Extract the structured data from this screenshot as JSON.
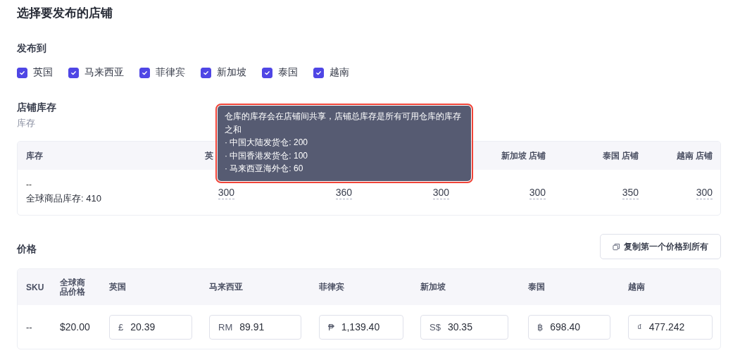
{
  "title": "选择要发布的店铺",
  "publish_to": {
    "label": "发布到",
    "options": [
      {
        "label": "英国",
        "checked": true
      },
      {
        "label": "马来西亚",
        "checked": true
      },
      {
        "label": "菲律宾",
        "checked": true
      },
      {
        "label": "新加坡",
        "checked": true
      },
      {
        "label": "泰国",
        "checked": true
      },
      {
        "label": "越南",
        "checked": true
      }
    ]
  },
  "inventory": {
    "heading": "店铺库存",
    "subheading": "库存",
    "columns": [
      "库存",
      "英",
      "新加坡 店铺",
      "泰国 店铺",
      "越南 店铺"
    ],
    "rows": [
      {
        "sku": "--",
        "global_stock": "全球商品库存: 410",
        "values": [
          "300",
          "360",
          "300",
          "300",
          "350",
          "300"
        ]
      }
    ]
  },
  "tooltip": {
    "text": "仓库的库存会在店铺间共享，店铺总库存是所有可用仓库的库存之和",
    "items": [
      "· 中国大陆发货仓: 200",
      "· 中国香港发货仓: 100",
      "· 马来西亚海外仓: 60"
    ],
    "highlighted": true
  },
  "price": {
    "heading": "价格",
    "copy_button": "复制第一个价格到所有",
    "columns": [
      "SKU",
      "全球商品价格",
      "英国",
      "马来西亚",
      "菲律宾",
      "新加坡",
      "泰国",
      "越南"
    ],
    "rows": [
      {
        "sku": "--",
        "global_price": "$20.00",
        "prices": [
          {
            "currency": "£",
            "value": "20.39"
          },
          {
            "currency": "RM",
            "value": "89.91"
          },
          {
            "currency": "₱",
            "value": "1,139.40"
          },
          {
            "currency": "S$",
            "value": "30.35"
          },
          {
            "currency": "฿",
            "value": "698.40"
          },
          {
            "currency": "₫",
            "value": "477.242"
          }
        ]
      }
    ]
  }
}
